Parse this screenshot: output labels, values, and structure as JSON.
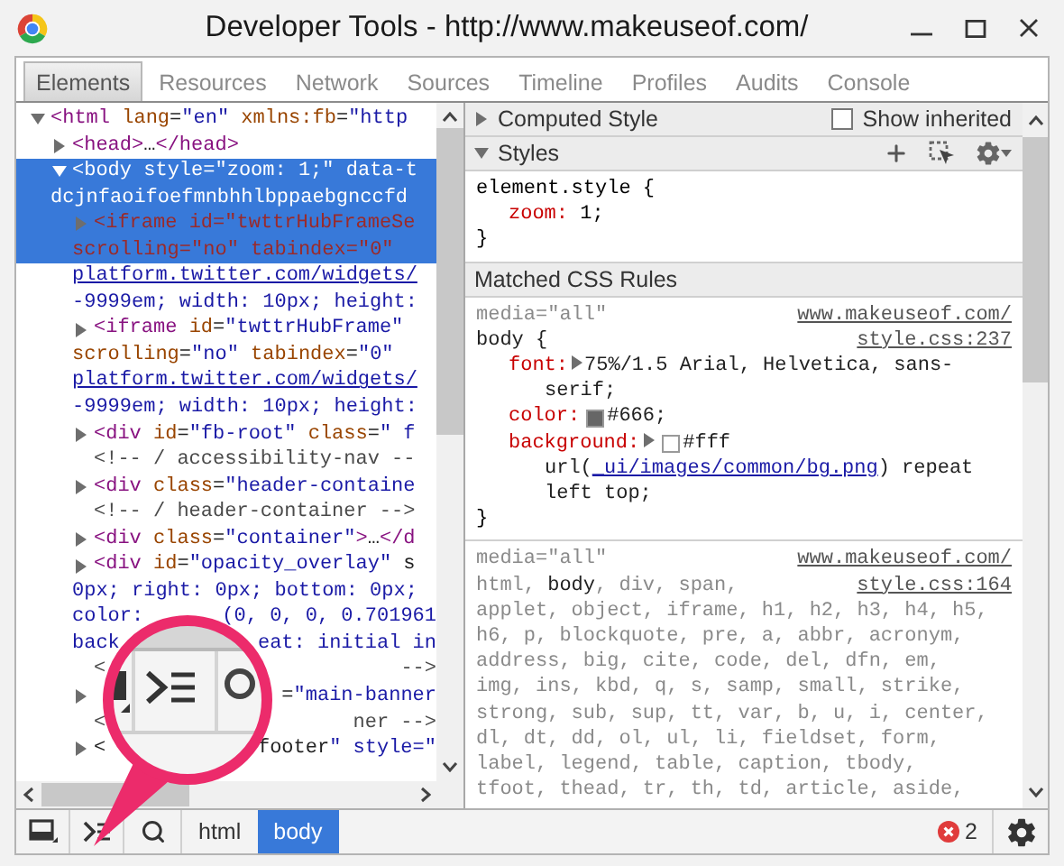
{
  "window": {
    "title": "Developer Tools - http://www.makeuseof.com/"
  },
  "tabs": [
    {
      "label": "Elements",
      "selected": true
    },
    {
      "label": "Resources",
      "selected": false
    },
    {
      "label": "Network",
      "selected": false
    },
    {
      "label": "Sources",
      "selected": false
    },
    {
      "label": "Timeline",
      "selected": false
    },
    {
      "label": "Profiles",
      "selected": false
    },
    {
      "label": "Audits",
      "selected": false
    },
    {
      "label": "Console",
      "selected": false
    }
  ],
  "dom_tree": [
    {
      "kind": "element",
      "expanded": true,
      "selected": false,
      "lines": [
        {
          "kind": "code",
          "text": "<html lang=\"en\" xmlns:fb=\"http"
        }
      ],
      "children": [
        {
          "kind": "element",
          "expanded": false,
          "selected": false,
          "lines": [
            {
              "kind": "code",
              "text": "<head>…</head>"
            }
          ]
        },
        {
          "kind": "element",
          "expanded": true,
          "selected": true,
          "lines": [
            {
              "kind": "code",
              "text": "<body style=\"zoom: 1;\" data-t"
            },
            {
              "kind": "value",
              "text": "dcjnfaoifoefmnbhhlbppaebgnccfd"
            }
          ],
          "children": [
            {
              "kind": "element",
              "expanded": false,
              "selected": false,
              "lines": [
                {
                  "kind": "code",
                  "text": "<iframe id=\"twttrHubFrameSe",
                  "highlight": true
                },
                {
                  "kind": "code",
                  "text": "scrolling=\"no\" tabindex=\"0\"",
                  "highlight": true
                },
                {
                  "kind": "link",
                  "text": "platform.twitter.com/widgets/"
                },
                {
                  "kind": "value",
                  "text": "-9999em; width: 10px; height:"
                }
              ]
            },
            {
              "kind": "element",
              "expanded": false,
              "selected": false,
              "lines": [
                {
                  "kind": "code",
                  "text": "<iframe id=\"twttrHubFrame\""
                },
                {
                  "kind": "code",
                  "text": "scrolling=\"no\" tabindex=\"0\""
                },
                {
                  "kind": "link",
                  "text": "platform.twitter.com/widgets/"
                },
                {
                  "kind": "value",
                  "text": "-9999em; width: 10px; height:"
                }
              ]
            },
            {
              "kind": "element",
              "expanded": false,
              "selected": false,
              "lines": [
                {
                  "kind": "code",
                  "text": "<div id=\"fb-root\" class=\" f"
                }
              ]
            },
            {
              "kind": "comment",
              "selected": false,
              "lines": [
                {
                  "kind": "comment",
                  "text": "<!-- / accessibility-nav --"
                }
              ]
            },
            {
              "kind": "element",
              "expanded": false,
              "selected": false,
              "lines": [
                {
                  "kind": "code",
                  "text": "<div class=\"header-containe"
                }
              ]
            },
            {
              "kind": "comment",
              "selected": false,
              "lines": [
                {
                  "kind": "comment",
                  "text": "<!-- / header-container -->"
                }
              ]
            },
            {
              "kind": "element",
              "expanded": false,
              "selected": false,
              "lines": [
                {
                  "kind": "code",
                  "text": "<div class=\"container\">…</d"
                }
              ]
            },
            {
              "kind": "element",
              "expanded": false,
              "selected": false,
              "lines": [
                {
                  "kind": "code",
                  "text": "<div id=\"opacity_overlay\" s"
                },
                {
                  "kind": "value",
                  "text": "0px; right: 0px; bottom: 0px;"
                },
                {
                  "kind": "value",
                  "text": "color:",
                  "after": "(0, 0, 0, 0.701961"
                },
                {
                  "kind": "value",
                  "text": "back",
                  "after": "eat: initial in"
                }
              ]
            },
            {
              "kind": "comment",
              "selected": false,
              "lines": [
                {
                  "kind": "comment",
                  "text": "<",
                  "after": "-->"
                }
              ]
            },
            {
              "kind": "element",
              "expanded": false,
              "selected": false,
              "lines": [
                {
                  "kind": "code",
                  "after": "=\"main-banner"
                }
              ]
            },
            {
              "kind": "comment",
              "selected": false,
              "lines": [
                {
                  "kind": "comment",
                  "text": "<",
                  "after": "ner -->"
                }
              ]
            },
            {
              "kind": "element",
              "expanded": false,
              "selected": false,
              "lines": [
                {
                  "kind": "code",
                  "text": "<",
                  "after": "footer\" style=\""
                }
              ]
            }
          ]
        }
      ]
    }
  ],
  "computed_style": {
    "title": "Computed Style",
    "expanded": false,
    "show_inherited": {
      "label": "Show inherited",
      "checked": false
    }
  },
  "styles": {
    "title": "Styles",
    "expanded": true,
    "element_style": {
      "selector": "element.style {",
      "properties": [
        {
          "name": "zoom:",
          "value": "1;"
        }
      ],
      "close": "}"
    }
  },
  "matched_rules": {
    "title": "Matched CSS Rules",
    "rules": [
      {
        "media": "media=\"all\"",
        "source_lines": [
          "www.makeuseof.com/",
          "style.css:237"
        ],
        "selector_lines": [
          [
            {
              "text": "body {",
              "matched": true
            }
          ]
        ],
        "properties": [
          {
            "name": "font:",
            "expandable": true,
            "has_swatch": false,
            "lines": [
              [
                {
                  "kind": "text",
                  "text": "75%/1.5 Arial, Helvetica, sans-"
                }
              ],
              [
                {
                  "kind": "text",
                  "text": "serif;"
                }
              ]
            ]
          },
          {
            "name": "color:",
            "expandable": false,
            "has_swatch": true,
            "lines": [
              [
                {
                  "kind": "text",
                  "text": "#666;"
                }
              ]
            ]
          },
          {
            "name": "background:",
            "expandable": true,
            "has_swatch": true,
            "lines": [
              [
                {
                  "kind": "text",
                  "text": "#fff"
                }
              ],
              [
                {
                  "kind": "text",
                  "text": "url("
                },
                {
                  "kind": "link",
                  "text": "_ui/images/common/bg.png"
                },
                {
                  "kind": "text",
                  "text": ") repeat"
                }
              ],
              [
                {
                  "kind": "text",
                  "text": "left top;"
                }
              ]
            ]
          }
        ],
        "close": "}"
      },
      {
        "media": "media=\"all\"",
        "source_lines": [
          "www.makeuseof.com/",
          "style.css:164"
        ],
        "selector_lines": [
          [
            {
              "text": "html, ",
              "matched": false
            },
            {
              "text": "body",
              "matched": true
            },
            {
              "text": ", div, span,",
              "matched": false
            }
          ],
          [
            {
              "text": "applet, object, iframe, h1, h2, h3, h4, h5,",
              "matched": false
            }
          ],
          [
            {
              "text": "h6, p, blockquote, pre, a, abbr, acronym,",
              "matched": false
            }
          ],
          [
            {
              "text": "address, big, cite, code, del, dfn, em,",
              "matched": false
            }
          ],
          [
            {
              "text": "img, ins, kbd, q, s, samp, small, strike,",
              "matched": false
            }
          ],
          [
            {
              "text": "strong, sub, sup, tt, var, b, u, i, center,",
              "matched": false
            }
          ],
          [
            {
              "text": "dl, dt, dd, ol, ul, li, fieldset, form,",
              "matched": false
            }
          ],
          [
            {
              "text": "label, legend, table, caption, tbody,",
              "matched": false
            }
          ],
          [
            {
              "text": "tfoot, thead, tr, th, td, article, aside,",
              "matched": false
            }
          ]
        ]
      }
    ]
  },
  "breadcrumbs": [
    {
      "label": "html",
      "selected": false
    },
    {
      "label": "body",
      "selected": true
    }
  ],
  "error_count": "2"
}
